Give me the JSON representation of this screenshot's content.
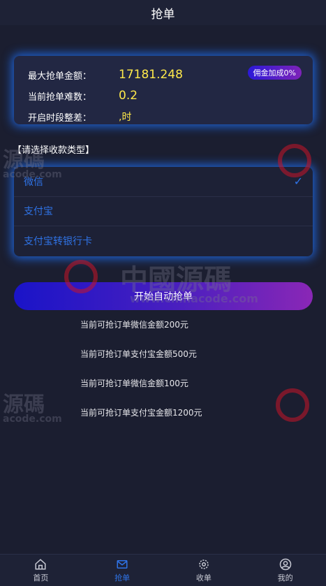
{
  "header": {
    "title": "抢单"
  },
  "info": {
    "max_amount_label": "最大抢单金额：",
    "max_amount_value": "17181.248",
    "difficulty_label": "当前抢单难数：",
    "difficulty_value": "0.2",
    "period_label": "开启时段整差：",
    "period_value": ",时",
    "badge": "佣金加成0%"
  },
  "payment": {
    "title": "【请选择收款类型】",
    "options": [
      {
        "label": "微信",
        "selected": true
      },
      {
        "label": "支付宝",
        "selected": false
      },
      {
        "label": "支付宝转银行卡",
        "selected": false
      }
    ]
  },
  "start_button": "开始自动抢单",
  "orders": [
    "当前可抢订单微信金额200元",
    "当前可抢订单支付宝金额500元",
    "当前可抢订单微信金额100元",
    "当前可抢订单支付宝金额1200元"
  ],
  "watermark": {
    "text": "中國源碼",
    "url": "www.chinacode.com",
    "short_text": "源碼",
    "short_url": "acode.com"
  },
  "tabbar": {
    "items": [
      {
        "label": "首页",
        "icon": "home-icon",
        "active": false
      },
      {
        "label": "抢单",
        "icon": "mail-icon",
        "active": true
      },
      {
        "label": "收单",
        "icon": "gear-icon",
        "active": false
      },
      {
        "label": "我的",
        "icon": "user-icon",
        "active": false
      }
    ]
  },
  "colors": {
    "accent": "#2f73e6",
    "value_yellow": "#ffe94a",
    "background": "#1b1e30"
  }
}
